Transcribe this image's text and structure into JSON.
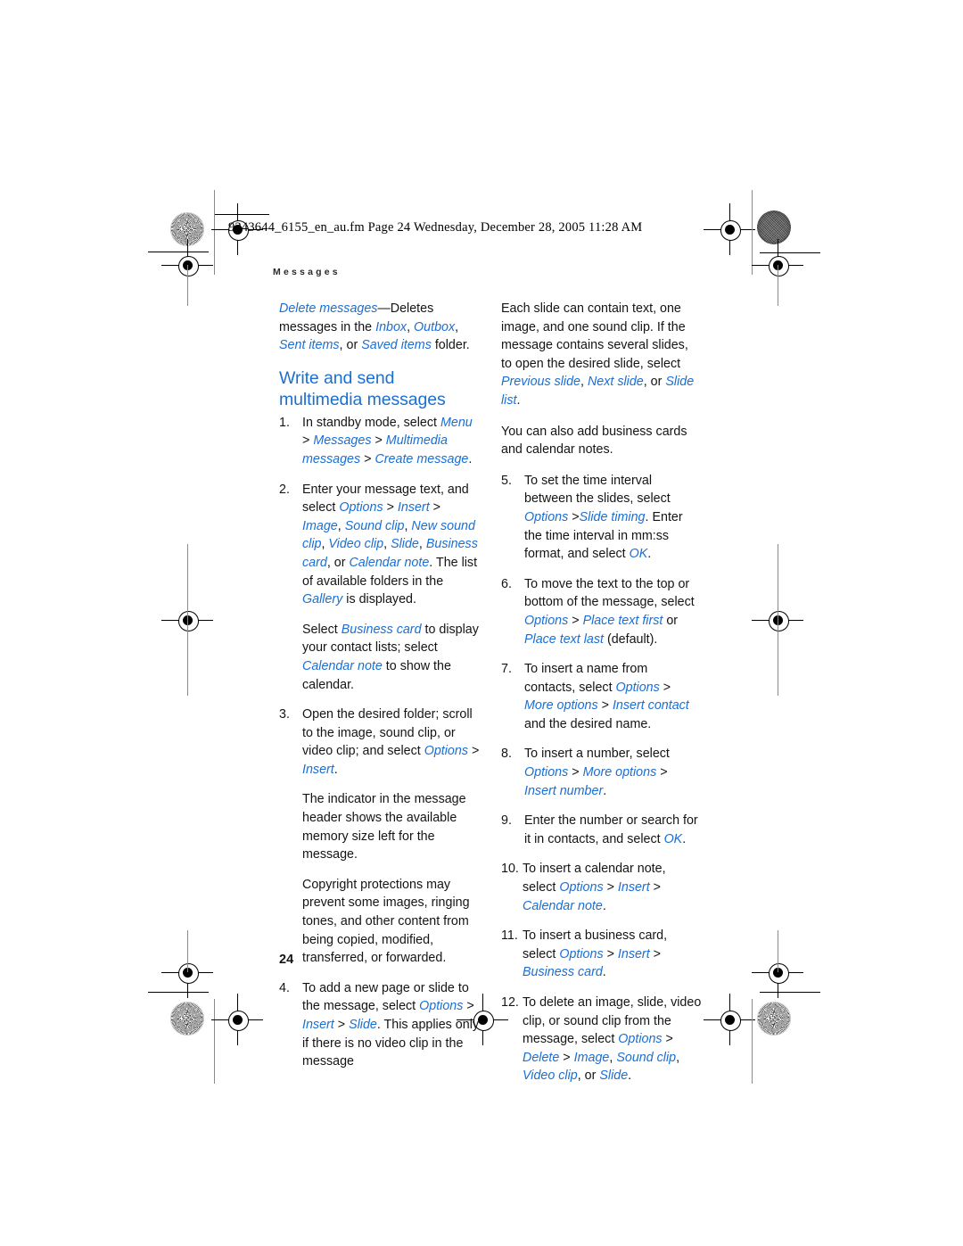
{
  "page": {
    "filestamp": "9243644_6155_en_au.fm  Page 24  Wednesday, December 28, 2005  11:28 AM",
    "running_header": "Messages",
    "page_number": "24",
    "accent_color": "#1b6fd4",
    "text_color": "#141414"
  },
  "left_column": {
    "intro_paragraph": {
      "t1": "Delete messages",
      "t2": "—Deletes messages in the ",
      "t3": "Inbox",
      "t4": ", ",
      "t5": "Outbox",
      "t6": ", ",
      "t7": "Sent items",
      "t8": ", or ",
      "t9": "Saved items",
      "t10": " folder."
    },
    "section_title": "Write and send multimedia messages",
    "steps": [
      {
        "num": "1.",
        "parts": [
          {
            "text": "In standby mode, select ",
            "style": "plain"
          },
          {
            "text": "Menu",
            "style": "ui"
          },
          {
            "text": " > ",
            "style": "plain"
          },
          {
            "text": "Messages",
            "style": "ui"
          },
          {
            "text": " > ",
            "style": "plain"
          },
          {
            "text": "Multimedia messages",
            "style": "ui"
          },
          {
            "text": " > ",
            "style": "plain"
          },
          {
            "text": "Create message",
            "style": "ui"
          },
          {
            "text": ".",
            "style": "plain"
          }
        ]
      },
      {
        "num": "2.",
        "parts": [
          {
            "text": "Enter your message text, and select ",
            "style": "plain"
          },
          {
            "text": "Options",
            "style": "ui"
          },
          {
            "text": " > ",
            "style": "plain"
          },
          {
            "text": "Insert",
            "style": "ui"
          },
          {
            "text": " > ",
            "style": "plain"
          },
          {
            "text": "Image",
            "style": "ui"
          },
          {
            "text": ", ",
            "style": "plain"
          },
          {
            "text": "Sound clip",
            "style": "ui"
          },
          {
            "text": ", ",
            "style": "plain"
          },
          {
            "text": "New sound clip",
            "style": "ui"
          },
          {
            "text": ", ",
            "style": "plain"
          },
          {
            "text": "Video clip",
            "style": "ui"
          },
          {
            "text": ", ",
            "style": "plain"
          },
          {
            "text": "Slide",
            "style": "ui"
          },
          {
            "text": ", ",
            "style": "plain"
          },
          {
            "text": "Business card",
            "style": "ui"
          },
          {
            "text": ", or ",
            "style": "plain"
          },
          {
            "text": "Calendar note",
            "style": "ui"
          },
          {
            "text": ". The list of available folders in the ",
            "style": "plain"
          },
          {
            "text": "Gallery",
            "style": "ui"
          },
          {
            "text": " is displayed.",
            "style": "plain"
          }
        ],
        "sub_paragraphs": [
          [
            {
              "text": "Select ",
              "style": "plain"
            },
            {
              "text": "Business card",
              "style": "ui"
            },
            {
              "text": " to display your contact lists; select ",
              "style": "plain"
            },
            {
              "text": "Calendar note",
              "style": "ui"
            },
            {
              "text": " to show the calendar.",
              "style": "plain"
            }
          ]
        ]
      },
      {
        "num": "3.",
        "parts": [
          {
            "text": "Open the desired folder; scroll to the image, sound clip, or video clip; and select ",
            "style": "plain"
          },
          {
            "text": "Options",
            "style": "ui"
          },
          {
            "text": " > ",
            "style": "plain"
          },
          {
            "text": "Insert",
            "style": "ui"
          },
          {
            "text": ".",
            "style": "plain"
          }
        ],
        "sub_paragraphs": [
          [
            {
              "text": "The indicator in the message header shows the available memory size left for the message.",
              "style": "plain"
            }
          ],
          [
            {
              "text": "Copyright protections may prevent some images, ringing tones, and other content from being copied, modified, transferred, or forwarded.",
              "style": "plain"
            }
          ]
        ]
      },
      {
        "num": "4.",
        "parts": [
          {
            "text": "To add a new page or slide to the message, select ",
            "style": "plain"
          },
          {
            "text": "Options",
            "style": "ui"
          },
          {
            "text": " > ",
            "style": "plain"
          },
          {
            "text": "Insert",
            "style": "ui"
          },
          {
            "text": " > ",
            "style": "plain"
          },
          {
            "text": "Slide",
            "style": "ui"
          },
          {
            "text": ". This applies only if there is no video clip in the message",
            "style": "plain"
          }
        ]
      }
    ]
  },
  "right_column": {
    "lead_paragraphs": [
      [
        {
          "text": "Each slide can contain text, one image, and one sound clip. If the message contains several slides, to open the desired slide, select ",
          "style": "plain"
        },
        {
          "text": "Previous slide",
          "style": "ui"
        },
        {
          "text": ", ",
          "style": "plain"
        },
        {
          "text": "Next slide",
          "style": "ui"
        },
        {
          "text": ", or ",
          "style": "plain"
        },
        {
          "text": "Slide list",
          "style": "ui"
        },
        {
          "text": ".",
          "style": "plain"
        }
      ],
      [
        {
          "text": "You can also add business cards and calendar notes.",
          "style": "plain"
        }
      ]
    ],
    "steps": [
      {
        "num": "5.",
        "parts": [
          {
            "text": "To set the time interval between the slides, select ",
            "style": "plain"
          },
          {
            "text": "Options",
            "style": "ui"
          },
          {
            "text": " >",
            "style": "plain"
          },
          {
            "text": "Slide timing",
            "style": "ui"
          },
          {
            "text": ". Enter the time interval in mm:ss format, and select ",
            "style": "plain"
          },
          {
            "text": "OK",
            "style": "ui"
          },
          {
            "text": ".",
            "style": "plain"
          }
        ]
      },
      {
        "num": "6.",
        "parts": [
          {
            "text": "To move the text to the top or bottom of the message, select ",
            "style": "plain"
          },
          {
            "text": "Options",
            "style": "ui"
          },
          {
            "text": " > ",
            "style": "plain"
          },
          {
            "text": "Place text first",
            "style": "ui"
          },
          {
            "text": " or ",
            "style": "plain"
          },
          {
            "text": "Place text last",
            "style": "ui"
          },
          {
            "text": " (default).",
            "style": "plain"
          }
        ]
      },
      {
        "num": "7.",
        "parts": [
          {
            "text": "To insert a name from contacts, select ",
            "style": "plain"
          },
          {
            "text": "Options",
            "style": "ui"
          },
          {
            "text": " > ",
            "style": "plain"
          },
          {
            "text": "More options",
            "style": "ui"
          },
          {
            "text": " > ",
            "style": "plain"
          },
          {
            "text": "Insert contact",
            "style": "ui"
          },
          {
            "text": " and the desired name.",
            "style": "plain"
          }
        ]
      },
      {
        "num": "8.",
        "parts": [
          {
            "text": "To insert a number, select ",
            "style": "plain"
          },
          {
            "text": "Options",
            "style": "ui"
          },
          {
            "text": " > ",
            "style": "plain"
          },
          {
            "text": "More options",
            "style": "ui"
          },
          {
            "text": " > ",
            "style": "plain"
          },
          {
            "text": "Insert number",
            "style": "ui"
          },
          {
            "text": ".",
            "style": "plain"
          }
        ]
      },
      {
        "num": "9.",
        "parts": [
          {
            "text": "Enter the number or search for it in contacts, and select ",
            "style": "plain"
          },
          {
            "text": "OK",
            "style": "ui"
          },
          {
            "text": ".",
            "style": "plain"
          }
        ]
      },
      {
        "num": "10.",
        "wide": true,
        "parts": [
          {
            "text": "To insert a calendar note, select ",
            "style": "plain"
          },
          {
            "text": "Options",
            "style": "ui"
          },
          {
            "text": " > ",
            "style": "plain"
          },
          {
            "text": "Insert",
            "style": "ui"
          },
          {
            "text": " > ",
            "style": "plain"
          },
          {
            "text": "Calendar note",
            "style": "ui"
          },
          {
            "text": ".",
            "style": "plain"
          }
        ]
      },
      {
        "num": "11.",
        "wide": true,
        "parts": [
          {
            "text": "To insert a business card, select ",
            "style": "plain"
          },
          {
            "text": "Options",
            "style": "ui"
          },
          {
            "text": " > ",
            "style": "plain"
          },
          {
            "text": "Insert",
            "style": "ui"
          },
          {
            "text": " > ",
            "style": "plain"
          },
          {
            "text": "Business card",
            "style": "ui"
          },
          {
            "text": ".",
            "style": "plain"
          }
        ]
      },
      {
        "num": "12.",
        "wide": true,
        "parts": [
          {
            "text": "To delete an image, slide, video clip, or sound clip from the message, select ",
            "style": "plain"
          },
          {
            "text": "Options",
            "style": "ui"
          },
          {
            "text": " > ",
            "style": "plain"
          },
          {
            "text": "Delete",
            "style": "ui"
          },
          {
            "text": " > ",
            "style": "plain"
          },
          {
            "text": "Image",
            "style": "ui"
          },
          {
            "text": ", ",
            "style": "plain"
          },
          {
            "text": "Sound clip",
            "style": "ui"
          },
          {
            "text": ", ",
            "style": "plain"
          },
          {
            "text": "Video clip",
            "style": "ui"
          },
          {
            "text": ", or ",
            "style": "plain"
          },
          {
            "text": "Slide",
            "style": "ui"
          },
          {
            "text": ".",
            "style": "plain"
          }
        ]
      }
    ]
  }
}
